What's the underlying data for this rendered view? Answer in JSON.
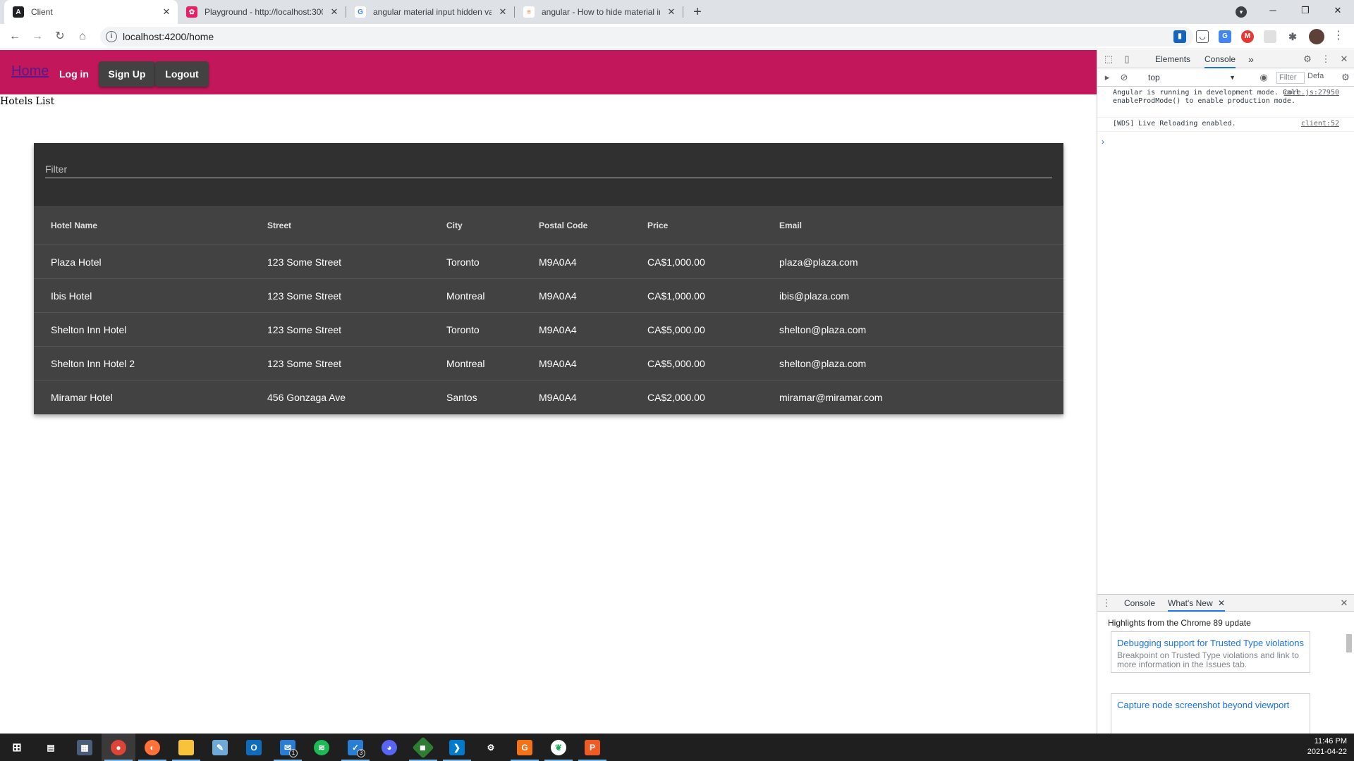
{
  "browser": {
    "tabs": [
      {
        "title": "Client",
        "icon": "angular-icon",
        "color": "#202124"
      },
      {
        "title": "Playground - http://localhost:300",
        "icon": "playground-icon",
        "color": "#e91e63"
      },
      {
        "title": "angular material input hidden va",
        "icon": "google-icon",
        "color": "#4285f4"
      },
      {
        "title": "angular - How to hide material in",
        "icon": "stackoverflow-icon",
        "color": "#f48024"
      }
    ],
    "new_tab": "+",
    "url": "localhost:4200/home"
  },
  "app": {
    "nav": {
      "home": "Home",
      "login": "Log in",
      "signup": "Sign Up",
      "logout": "Logout"
    },
    "heading": "Hotels List",
    "filter_placeholder": "Filter",
    "columns": [
      "Hotel Name",
      "Street",
      "City",
      "Postal Code",
      "Price",
      "Email"
    ],
    "rows": [
      [
        "Plaza Hotel",
        "123 Some Street",
        "Toronto",
        "M9A0A4",
        "CA$1,000.00",
        "plaza@plaza.com"
      ],
      [
        "Ibis Hotel",
        "123 Some Street",
        "Montreal",
        "M9A0A4",
        "CA$1,000.00",
        "ibis@plaza.com"
      ],
      [
        "Shelton Inn Hotel",
        "123 Some Street",
        "Toronto",
        "M9A0A4",
        "CA$5,000.00",
        "shelton@plaza.com"
      ],
      [
        "Shelton Inn Hotel 2",
        "123 Some Street",
        "Montreal",
        "M9A0A4",
        "CA$5,000.00",
        "shelton@plaza.com"
      ],
      [
        "Miramar Hotel",
        "456 Gonzaga Ave",
        "Santos",
        "M9A0A4",
        "CA$2,000.00",
        "miramar@miramar.com"
      ]
    ],
    "colors": {
      "toolbar": "#c2185b",
      "table_bg": "#424242",
      "filter_bg": "#303030"
    }
  },
  "devtools": {
    "tabs": [
      "Elements",
      "Console"
    ],
    "more": "»",
    "context": "top",
    "filter_placeholder": "Filter",
    "levels": "Defa",
    "messages": [
      {
        "text": "Angular is running in development mode. Call enableProdMode() to enable production mode.",
        "source": "core.js:27950"
      },
      {
        "text": "[WDS] Live Reloading enabled.",
        "source": "client:52"
      }
    ],
    "prompt": "›",
    "drawer": {
      "tabs": [
        "Console",
        "What's New"
      ],
      "title": "Highlights from the Chrome 89 update",
      "cards": [
        {
          "heading": "Debugging support for Trusted Type violations",
          "desc": "Breakpoint on Trusted Type violations and link to more information in the Issues tab."
        },
        {
          "heading": "Capture node screenshot beyond viewport",
          "desc": ""
        }
      ]
    }
  },
  "taskbar": {
    "time": "11:46 PM",
    "date": "2021-04-22",
    "badges": {
      "outlook": "1",
      "vs": "3"
    }
  }
}
